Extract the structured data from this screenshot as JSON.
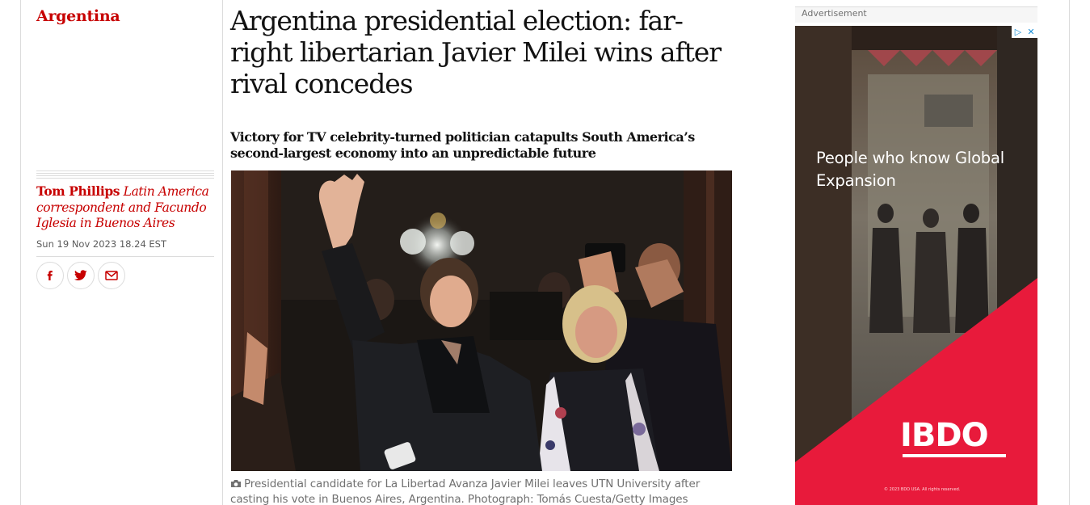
{
  "section": {
    "label": "Argentina"
  },
  "article": {
    "headline": "Argentina presidential election: far-right libertarian Javier Milei wins after rival concedes",
    "standfirst": "Victory for TV celebrity-turned politician catapults South America’s second-largest economy into an unpredictable future",
    "byline": {
      "author": "Tom Phillips",
      "role": "Latin America correspondent and Facundo Iglesia in Buenos Aires"
    },
    "date": "Sun 19 Nov 2023 18.24 EST",
    "caption": "Presidential candidate for La Libertad Avanza Javier Milei leaves UTN University after casting his vote in Buenos Aires, Argentina. Photograph: Tomás Cuesta/Getty Images"
  },
  "share": {
    "icons": [
      "facebook-icon",
      "twitter-icon",
      "email-icon"
    ]
  },
  "ad": {
    "label": "Advertisement",
    "headline": "People who know Global Expansion",
    "brand": "IBDO",
    "fineprint": "© 2023 BDO USA. All rights reserved.",
    "choices_icons": [
      "adchoices-icon",
      "close-icon"
    ],
    "colors": {
      "brand_red": "#e81a3b",
      "dark": "#3b3a36"
    }
  },
  "colors": {
    "accent": "#c70000",
    "text": "#121212",
    "muted": "#707070",
    "rule": "#dcdcdc"
  }
}
